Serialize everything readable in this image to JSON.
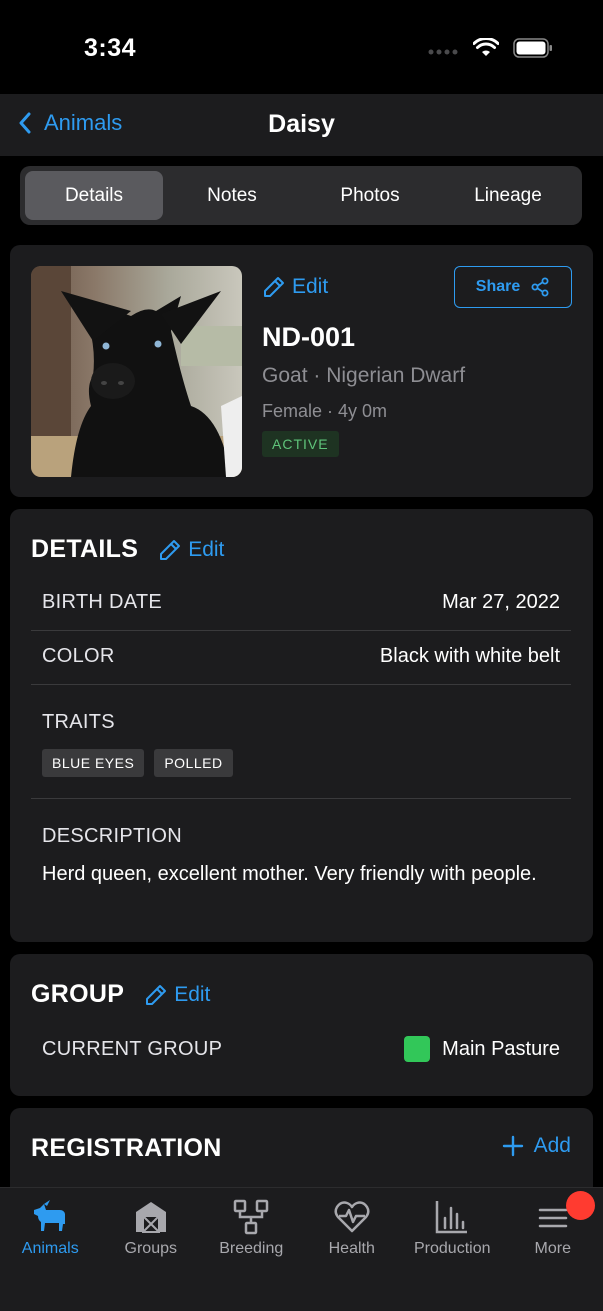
{
  "status_bar": {
    "time": "3:34"
  },
  "nav": {
    "back_label": "Animals",
    "title": "Daisy"
  },
  "segments": [
    "Details",
    "Notes",
    "Photos",
    "Lineage"
  ],
  "profile": {
    "edit_label": "Edit",
    "share_label": "Share",
    "id": "ND-001",
    "species_breed": "Goat · Nigerian Dwarf",
    "sex_age": "Female · 4y 0m",
    "status": "ACTIVE"
  },
  "details": {
    "title": "DETAILS",
    "edit_label": "Edit",
    "birth_date_label": "BIRTH DATE",
    "birth_date": "Mar 27, 2022",
    "color_label": "COLOR",
    "color": "Black with white belt",
    "traits_label": "TRAITS",
    "traits": [
      "BLUE EYES",
      "POLLED"
    ],
    "description_label": "DESCRIPTION",
    "description": "Herd queen, excellent mother. Very friendly with people."
  },
  "group": {
    "title": "GROUP",
    "edit_label": "Edit",
    "current_group_label": "CURRENT GROUP",
    "current_group": "Main Pasture",
    "swatch_color": "#32c759"
  },
  "registration": {
    "title": "REGISTRATION",
    "add_label": "Add"
  },
  "tabbar": {
    "tabs": [
      {
        "label": "Animals",
        "icon": "goat-icon",
        "active": true
      },
      {
        "label": "Groups",
        "icon": "barn-icon"
      },
      {
        "label": "Breeding",
        "icon": "tree-icon"
      },
      {
        "label": "Health",
        "icon": "heart-pulse-icon"
      },
      {
        "label": "Production",
        "icon": "bar-chart-icon"
      },
      {
        "label": "More",
        "icon": "menu-icon",
        "badge": true
      }
    ]
  },
  "colors": {
    "accent": "#2e9bf0",
    "background": "#000000",
    "card": "#1c1c1e",
    "active_badge": "#5fc47a"
  }
}
